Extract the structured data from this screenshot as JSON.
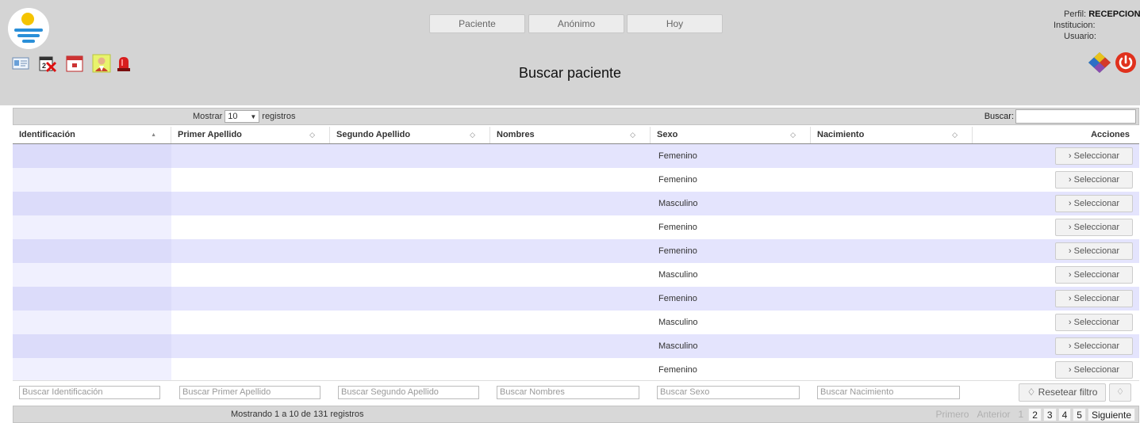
{
  "header": {
    "title": "Buscar paciente",
    "nav": [
      {
        "label": "Paciente"
      },
      {
        "label": "Anónimo"
      },
      {
        "label": "Hoy"
      }
    ],
    "user": {
      "perfil_label": "Perfil:",
      "perfil_value": "RECEPCIONISTA",
      "institucion_label": "Institucion:",
      "usuario_label": "Usuario:"
    },
    "toolbar_icons": [
      "id-card-icon",
      "calendar-cancel-icon",
      "calendar-icon",
      "doctor-icon",
      "alarm-light-icon"
    ],
    "corner_icons": [
      "colored-cube-icon",
      "power-icon"
    ]
  },
  "table_controls": {
    "show_label": "Mostrar",
    "show_value": "10",
    "records_label": "registros",
    "search_label": "Buscar:",
    "search_value": ""
  },
  "table": {
    "columns": [
      {
        "label": "Identificación",
        "sort": "▲"
      },
      {
        "label": "Primer Apellido",
        "sort": "◇"
      },
      {
        "label": "Segundo Apellido",
        "sort": "◇"
      },
      {
        "label": "Nombres",
        "sort": "◇"
      },
      {
        "label": "Sexo",
        "sort": "◇"
      },
      {
        "label": "Nacimiento",
        "sort": "◇"
      },
      {
        "label": "Acciones",
        "sort": ""
      }
    ],
    "rows": [
      {
        "sexo": "Femenino"
      },
      {
        "sexo": "Femenino"
      },
      {
        "sexo": "Masculino"
      },
      {
        "sexo": "Femenino"
      },
      {
        "sexo": "Femenino"
      },
      {
        "sexo": "Masculino"
      },
      {
        "sexo": "Femenino"
      },
      {
        "sexo": "Masculino"
      },
      {
        "sexo": "Masculino"
      },
      {
        "sexo": "Femenino"
      }
    ],
    "select_label": "›  Seleccionar",
    "filters": [
      {
        "placeholder": "Buscar Identificación"
      },
      {
        "placeholder": "Buscar Primer Apellido"
      },
      {
        "placeholder": "Buscar Segundo Apellido"
      },
      {
        "placeholder": "Buscar Nombres"
      },
      {
        "placeholder": "Buscar Sexo"
      },
      {
        "placeholder": "Buscar Nacimiento"
      }
    ],
    "reset_label": "♢ Resetear filtro",
    "reset_icon_label": "♢"
  },
  "footer": {
    "info": "Mostrando 1 a 10 de 131 registros",
    "pager": {
      "first": "Primero",
      "previous": "Anterior",
      "pages": [
        "1",
        "2",
        "3",
        "4",
        "5"
      ],
      "current": "1",
      "next": "Siguiente"
    }
  },
  "colors": {
    "header_bg": "#d4d4d4",
    "row_odd": "#e4e4fd",
    "row_even": "#ffffff",
    "power_red": "#e0311d"
  }
}
